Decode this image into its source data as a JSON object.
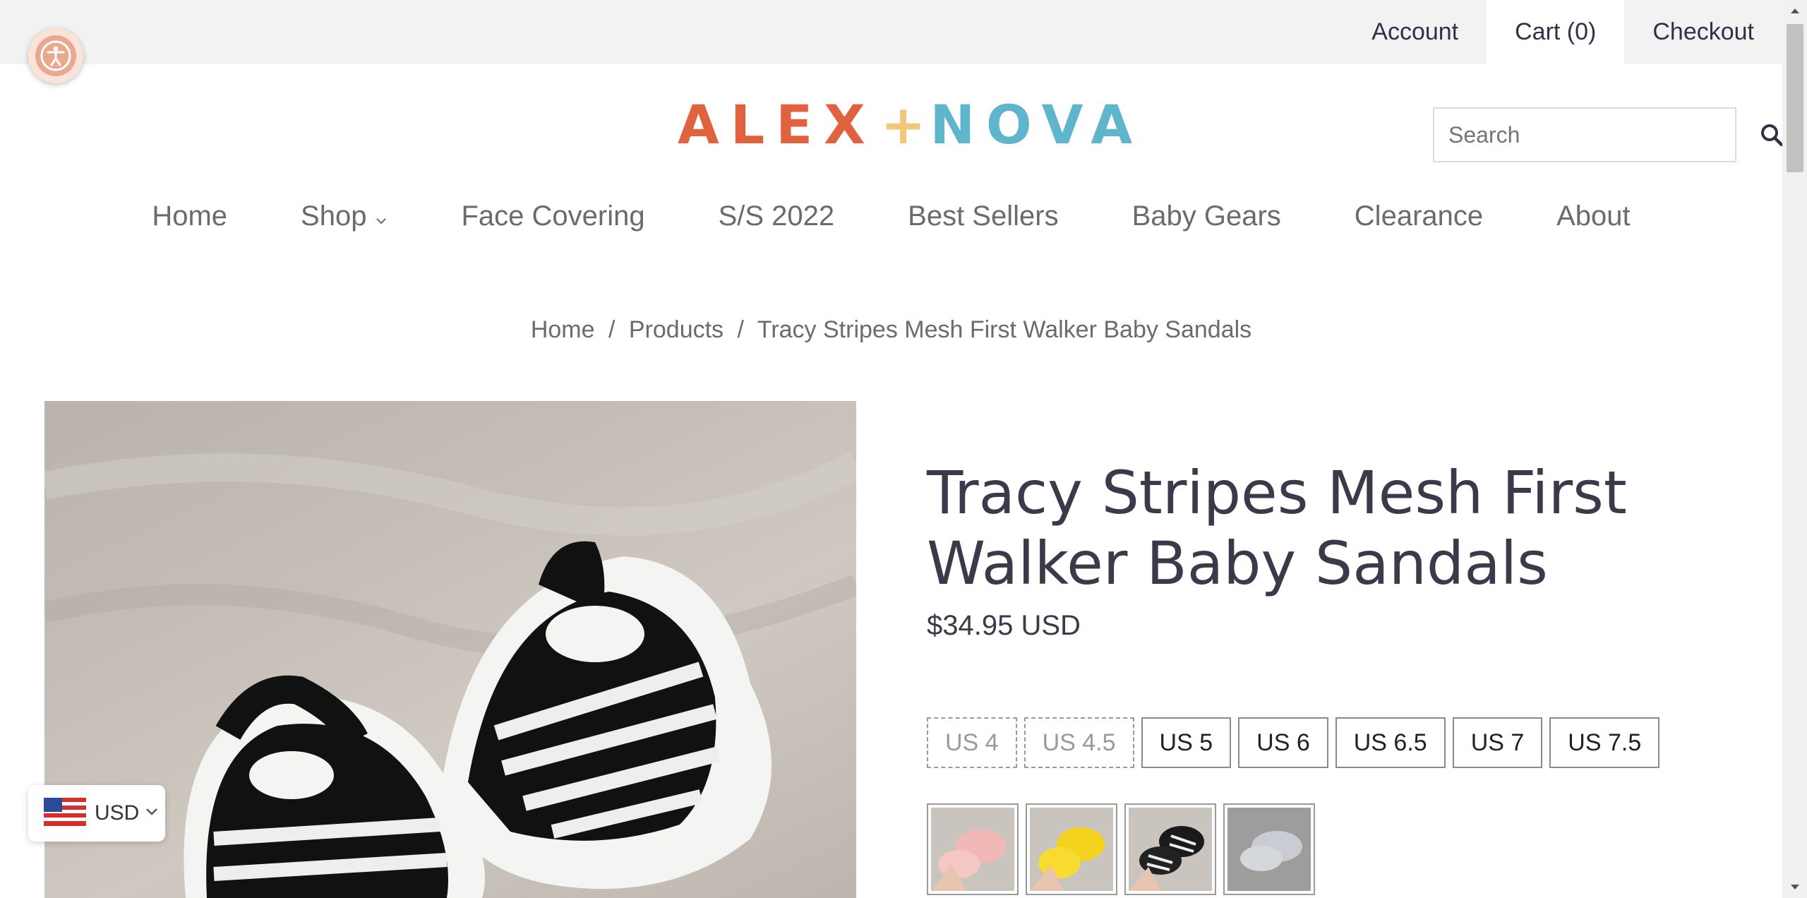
{
  "header": {
    "links": {
      "account": "Account",
      "cart": "Cart (0)",
      "checkout": "Checkout"
    },
    "search_placeholder": "Search",
    "logo": {
      "left": "ALEX",
      "plus": "+",
      "right": "NOVA"
    }
  },
  "nav": {
    "items": [
      "Home",
      "Shop",
      "Face Covering",
      "S/S 2022",
      "Best Sellers",
      "Baby Gears",
      "Clearance",
      "About"
    ]
  },
  "breadcrumb": {
    "home": "Home",
    "sep": "/",
    "products": "Products",
    "current": "Tracy Stripes Mesh First Walker Baby Sandals"
  },
  "product": {
    "title_line1": "Tracy Stripes Mesh First",
    "title_line2": "Walker Baby Sandals",
    "price": "$34.95 USD",
    "sizes": [
      {
        "label": "US 4",
        "available": false
      },
      {
        "label": "US 4.5",
        "available": false
      },
      {
        "label": "US 5",
        "available": true
      },
      {
        "label": "US 6",
        "available": true
      },
      {
        "label": "US 6.5",
        "available": true
      },
      {
        "label": "US 7",
        "available": true
      },
      {
        "label": "US 7.5",
        "available": true
      }
    ],
    "swatch_colors": [
      "pink",
      "yellow",
      "black",
      "gray"
    ]
  },
  "currency": {
    "code": "USD"
  },
  "colors": {
    "logo_orange": "#e0623f",
    "logo_blue": "#5fb6cc",
    "logo_plus": "#f2c77a",
    "text_dark": "#3a3b4a"
  }
}
